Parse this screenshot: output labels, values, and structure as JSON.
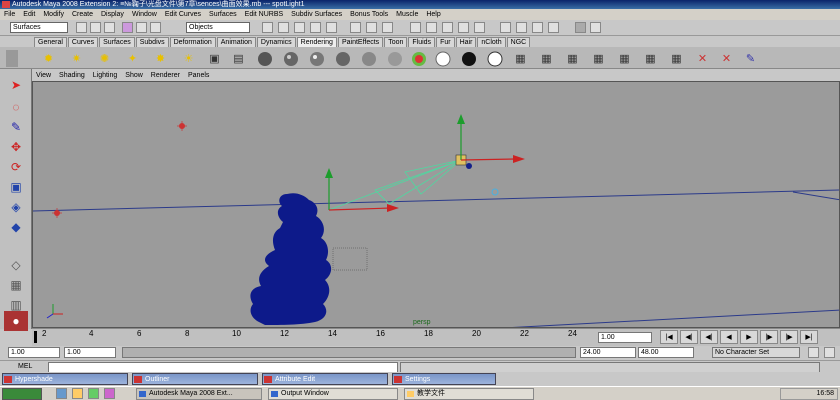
{
  "window": {
    "title": "Autodesk Maya 2008 Extension 2: ≡№鞠子\\光盘文件\\第7章\\sences\\曲面效果.mb  ---  spotLight1"
  },
  "watermark": {
    "text": "优酷"
  },
  "menubar": [
    "File",
    "Edit",
    "Modify",
    "Create",
    "Display",
    "Window",
    "Edit Curves",
    "Surfaces",
    "Edit NURBS",
    "Subdiv Surfaces",
    "Bonus Tools",
    "Muscle",
    "Help"
  ],
  "statusline": {
    "menuset": "Surfaces",
    "selection_mode": "Objects"
  },
  "shelf_tabs": [
    "General",
    "Curves",
    "Surfaces",
    "Subdivs",
    "Deformation",
    "Animation",
    "Dynamics",
    "Rendering",
    "PaintEffects",
    "Toon",
    "Fluids",
    "Fur",
    "Hair",
    "nCloth",
    "NGC"
  ],
  "active_shelf_tab": "Rendering",
  "panel_menu": [
    "View",
    "Shading",
    "Lighting",
    "Show",
    "Renderer",
    "Panels"
  ],
  "viewport": {
    "camera_label": "persp"
  },
  "timeline": {
    "ticks": [
      "2",
      "4",
      "6",
      "8",
      "10",
      "12",
      "14",
      "16",
      "18",
      "20",
      "22",
      "24"
    ],
    "current_frame": "1.00"
  },
  "range": {
    "start": "1.00",
    "playback_start": "1.00",
    "playback_end": "24.00",
    "end": "48.00",
    "character_set": "No Character Set"
  },
  "mel": {
    "label": "MEL"
  },
  "minimized_windows": [
    "Hypershade",
    "Outliner",
    "Attribute Edit",
    "Settings"
  ],
  "taskbar": {
    "tasks": [
      "Autodesk Maya 2008 Ext...",
      "Output Window",
      "教学文件"
    ],
    "clock": "16:58"
  },
  "colors": {
    "viewport_bg": "#9b9b9b",
    "model": "#0d1a8a",
    "grid": "#2b3a8a"
  }
}
